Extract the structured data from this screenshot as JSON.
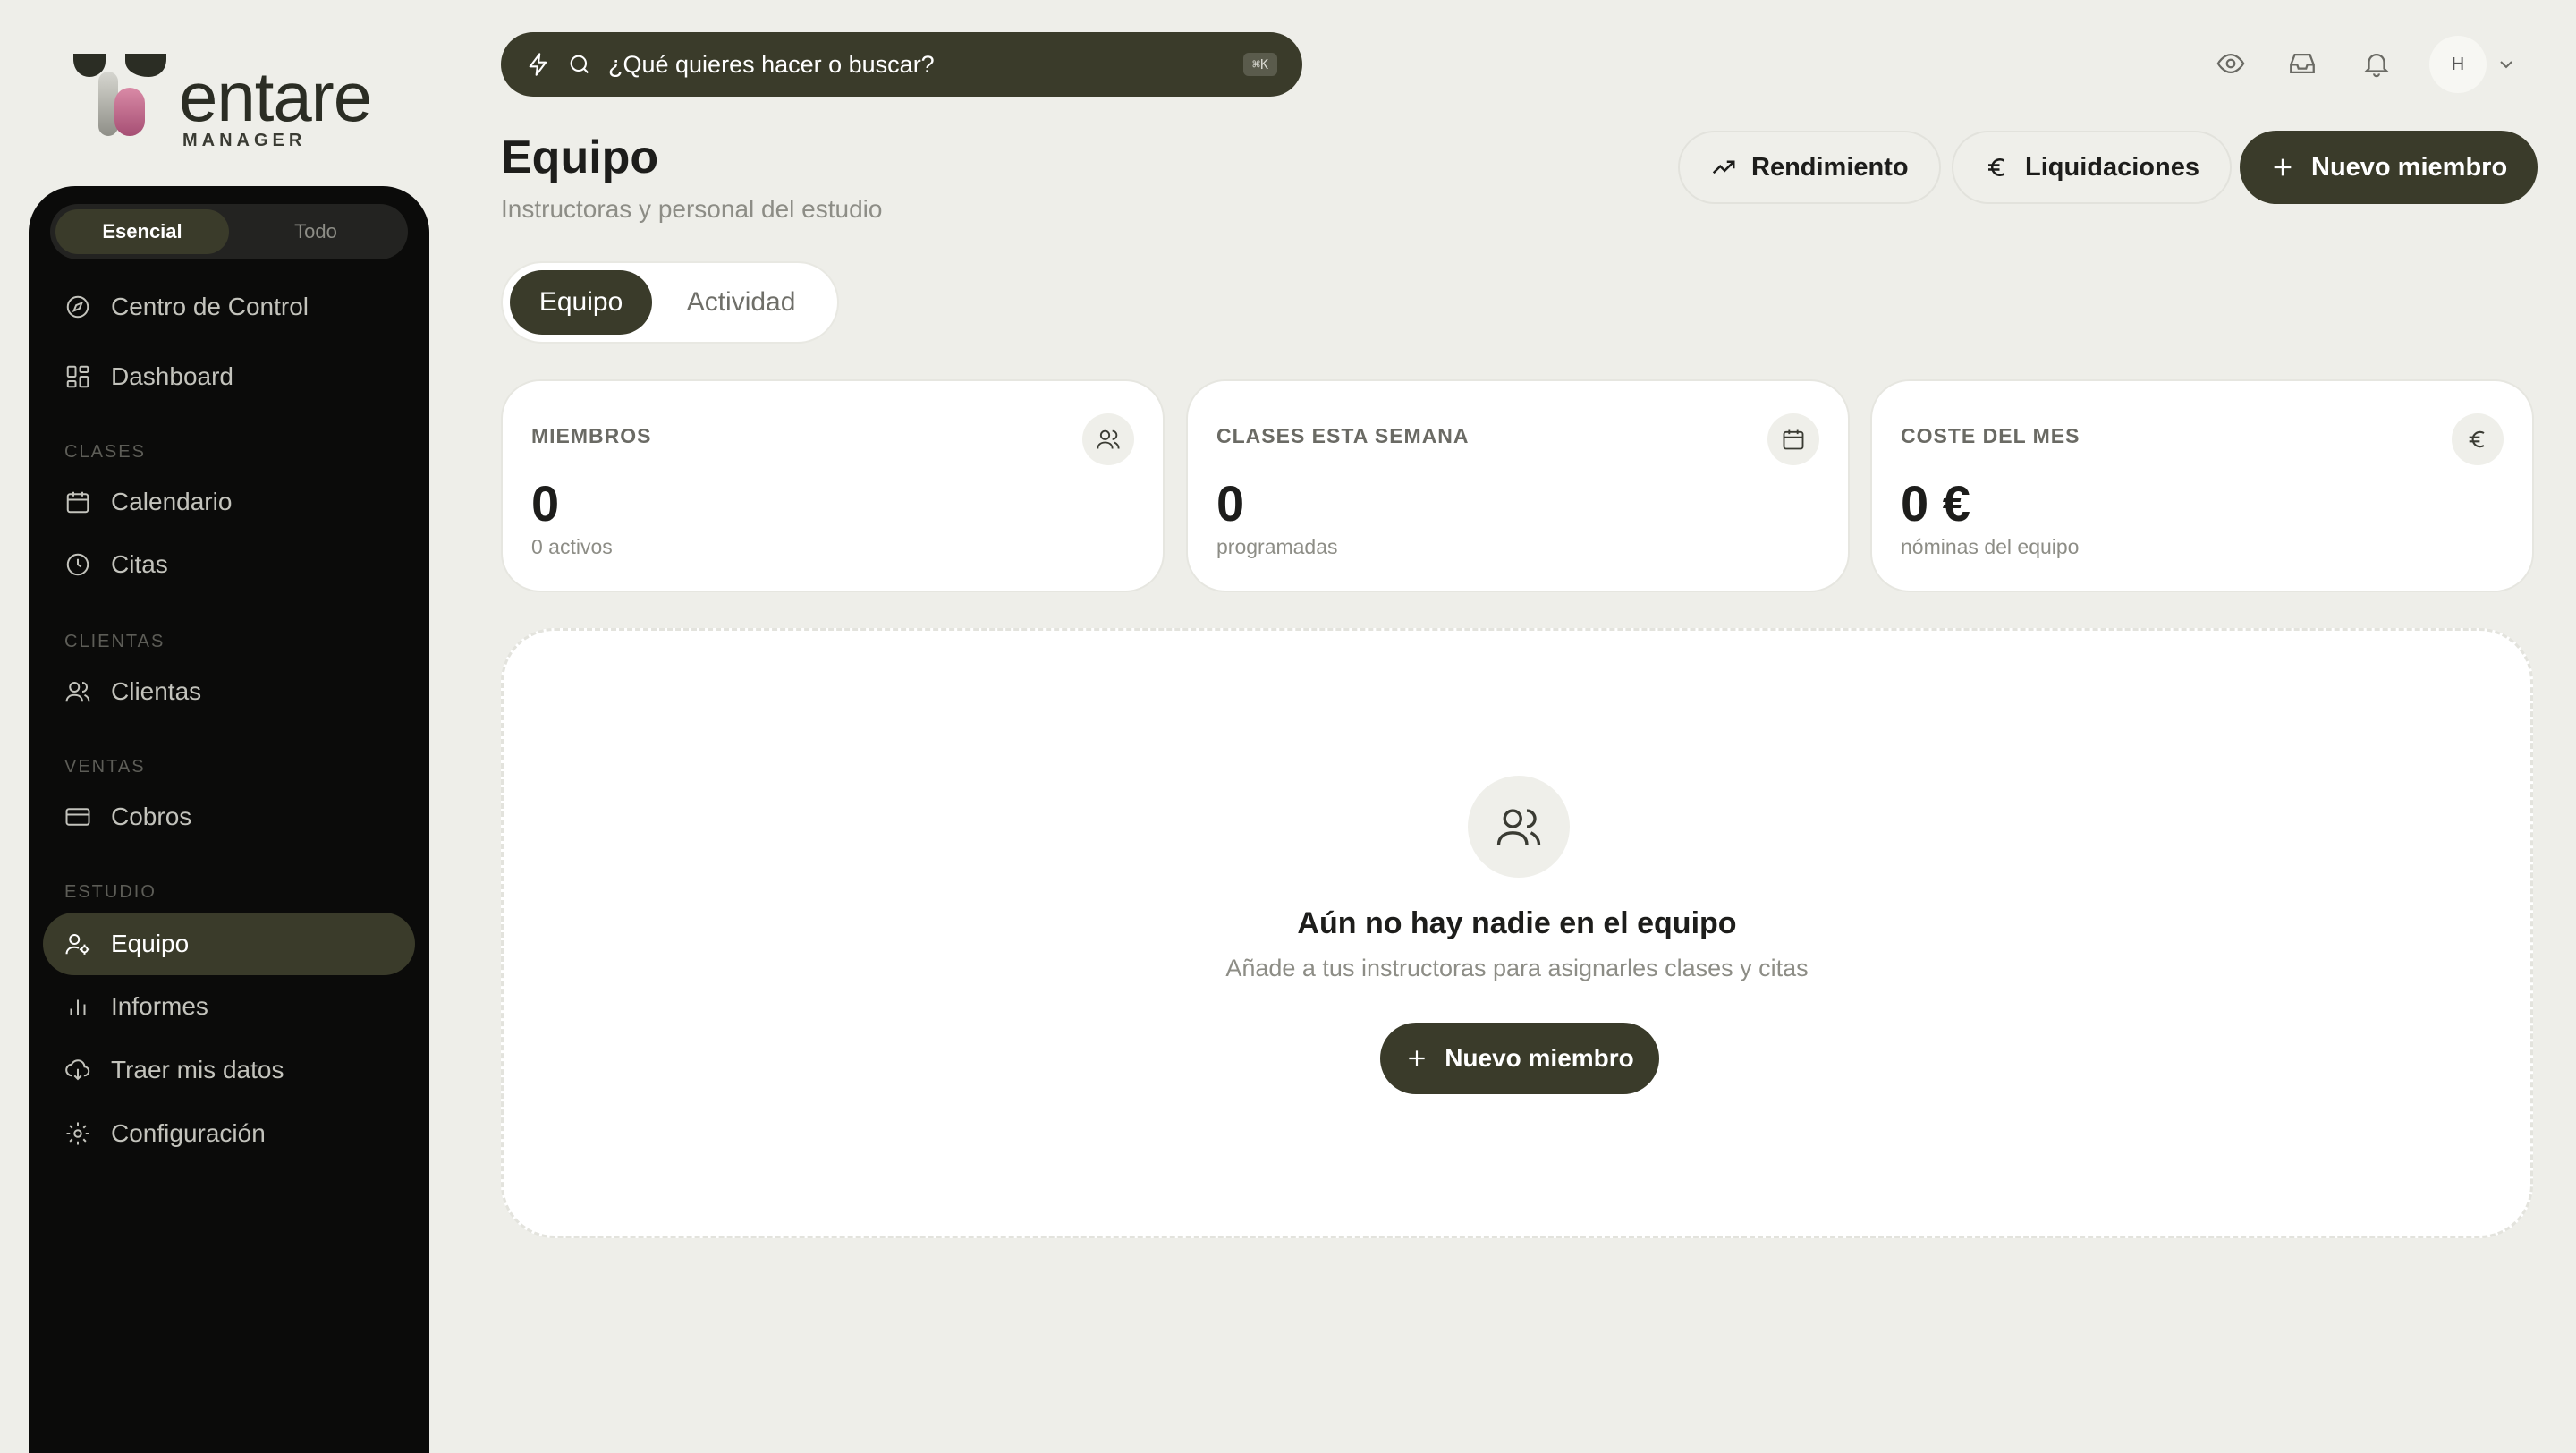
{
  "brand": {
    "name": "entare",
    "subtitle": "MANAGER"
  },
  "sidebar": {
    "modes": [
      "Esencial",
      "Todo"
    ],
    "sections": [
      "Clases",
      "Clientas",
      "Ventas",
      "Estudio"
    ],
    "items": [
      {
        "label": "Centro de Control",
        "icon": "compass-icon"
      },
      {
        "label": "Dashboard",
        "icon": "dashboard-icon"
      },
      {
        "label": "Calendario",
        "icon": "calendar-icon"
      },
      {
        "label": "Citas",
        "icon": "clock-icon"
      },
      {
        "label": "Clientas",
        "icon": "users-icon"
      },
      {
        "label": "Cobros",
        "icon": "credit-card-icon"
      },
      {
        "label": "Equipo",
        "icon": "user-gear-icon"
      },
      {
        "label": "Informes",
        "icon": "bar-chart-icon"
      },
      {
        "label": "Traer mis datos",
        "icon": "cloud-download-icon"
      },
      {
        "label": "Configuración",
        "icon": "gear-icon"
      }
    ]
  },
  "search": {
    "placeholder": "¿Qué quieres hacer o buscar?",
    "shortcut": "⌘K"
  },
  "user": {
    "initial": "H"
  },
  "header": {
    "title": "Equipo",
    "subtitle": "Instructoras y personal del estudio"
  },
  "actions": {
    "performance": "Rendimiento",
    "settlements": "Liquidaciones",
    "new_member": "Nuevo miembro"
  },
  "tabs": [
    "Equipo",
    "Actividad"
  ],
  "stats": [
    {
      "label": "MIEMBROS",
      "value": "0",
      "sub": "0 activos",
      "icon": "users-icon"
    },
    {
      "label": "CLASES ESTA SEMANA",
      "value": "0",
      "sub": "programadas",
      "icon": "calendar-icon"
    },
    {
      "label": "COSTE DEL MES",
      "value": "0 €",
      "sub": "nóminas del equipo",
      "icon": "euro-icon"
    }
  ],
  "empty": {
    "title": "Aún no hay nadie en el equipo",
    "subtitle": "Añade a tus instructoras para asignarles clases y citas",
    "button": "Nuevo miembro"
  },
  "colors": {
    "accent": "#3a3b2a",
    "background": "#eeeee9",
    "sidebar": "#0b0b0a",
    "logo_pink": "#c06b8c"
  }
}
